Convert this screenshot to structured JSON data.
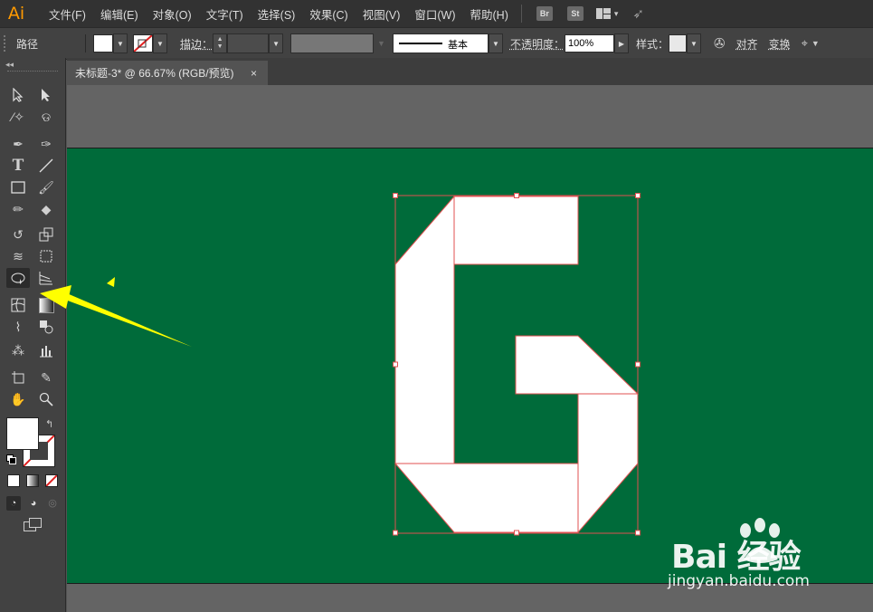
{
  "app": {
    "logo": "Ai"
  },
  "menu": [
    "文件(F)",
    "编辑(E)",
    "对象(O)",
    "文字(T)",
    "选择(S)",
    "效果(C)",
    "视图(V)",
    "窗口(W)",
    "帮助(H)"
  ],
  "bridge": {
    "br": "Br",
    "st": "St"
  },
  "control": {
    "path_label": "路径",
    "stroke_label": "描边：",
    "brush_label": "基本",
    "opacity_label": "不透明度：",
    "opacity_value": "100%",
    "style_label": "样式：",
    "align_label": "对齐",
    "transform_label": "变换"
  },
  "document": {
    "tab_title": "未标题-3* @ 66.67% (RGB/预览)",
    "close": "×"
  },
  "colors": {
    "artboard": "#006b3a",
    "selection": "#e04a4a",
    "arrow": "#ffff00"
  },
  "watermark": {
    "brand": "Bai 经验",
    "url": "jingyan.baidu.com"
  }
}
